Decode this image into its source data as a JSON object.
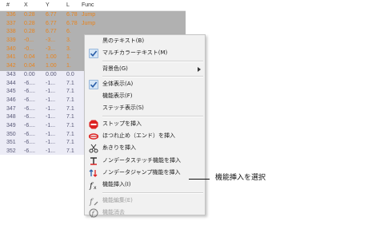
{
  "table": {
    "headers": [
      "#",
      "X",
      "Y",
      "L",
      "Func"
    ],
    "rows": [
      {
        "cells": [
          "336",
          "0.28",
          "6.77",
          "6.78",
          "Jump"
        ],
        "selected": true
      },
      {
        "cells": [
          "337",
          "0.28",
          "6.77",
          "6.78",
          "Jump"
        ],
        "selected": true
      },
      {
        "cells": [
          "338",
          "0.28",
          "6.77",
          "6.",
          ""
        ],
        "selected": true
      },
      {
        "cells": [
          "339",
          "-0...",
          "-3...",
          "3.",
          ""
        ],
        "selected": true
      },
      {
        "cells": [
          "340",
          "-0...",
          "-3...",
          "3.",
          ""
        ],
        "selected": true
      },
      {
        "cells": [
          "341",
          "0.04",
          "1.00",
          "1.",
          ""
        ],
        "selected": true
      },
      {
        "cells": [
          "342",
          "0.04",
          "1.00",
          "1.",
          ""
        ],
        "selected": true
      },
      {
        "cells": [
          "343",
          "0.00",
          "0.00",
          "0.0",
          ""
        ],
        "selected": false
      },
      {
        "cells": [
          "344",
          "-6....",
          "-1...",
          "7.1",
          ""
        ],
        "selected": false
      },
      {
        "cells": [
          "345",
          "-6....",
          "-1...",
          "7.1",
          ""
        ],
        "selected": false
      },
      {
        "cells": [
          "346",
          "-6....",
          "-1...",
          "7.1",
          ""
        ],
        "selected": false
      },
      {
        "cells": [
          "347",
          "-6....",
          "-1...",
          "7.1",
          ""
        ],
        "selected": false
      },
      {
        "cells": [
          "348",
          "-6....",
          "-1...",
          "7.1",
          ""
        ],
        "selected": false
      },
      {
        "cells": [
          "349",
          "-6....",
          "-1...",
          "7.1",
          ""
        ],
        "selected": false
      },
      {
        "cells": [
          "350",
          "-6....",
          "-1...",
          "7.1",
          ""
        ],
        "selected": false
      },
      {
        "cells": [
          "351",
          "-6....",
          "-1...",
          "7.1",
          ""
        ],
        "selected": false
      },
      {
        "cells": [
          "352",
          "-6....",
          "-1...",
          "7.1",
          ""
        ],
        "selected": false
      }
    ]
  },
  "menu": {
    "items": [
      {
        "label": "黒のテキスト(B)",
        "icon": "",
        "checked": false,
        "disabled": false
      },
      {
        "label": "マルチカラーテキスト(M)",
        "icon": "check-icon",
        "checked": true,
        "disabled": false
      },
      {
        "sep": true
      },
      {
        "label": "背景色(G)",
        "icon": "",
        "checked": false,
        "disabled": false,
        "submenu": true
      },
      {
        "sep": true
      },
      {
        "label": "全体表示(A)",
        "icon": "check-icon",
        "checked": true,
        "disabled": false
      },
      {
        "label": "機能表示(F)",
        "icon": "",
        "checked": false,
        "disabled": false
      },
      {
        "label": "ステッチ表示(S)",
        "icon": "",
        "checked": false,
        "disabled": false
      },
      {
        "sep": true
      },
      {
        "label": "ストップを挿入",
        "icon": "stop-icon",
        "checked": false,
        "disabled": false
      },
      {
        "label": "ほつれ止め（エンド）を挿入",
        "icon": "tie-off-icon",
        "checked": false,
        "disabled": false
      },
      {
        "label": "糸きりを挿入",
        "icon": "trim-icon",
        "checked": false,
        "disabled": false
      },
      {
        "label": "ノンデータステッチ機能を挿入",
        "icon": "stitch-function-icon",
        "checked": false,
        "disabled": false
      },
      {
        "label": "ノンデータジャンプ機能を挿入",
        "icon": "jump-function-icon",
        "checked": false,
        "disabled": false
      },
      {
        "label": "機能挿入(I)",
        "icon": "function-insert-icon",
        "checked": false,
        "disabled": false
      },
      {
        "sep": true
      },
      {
        "label": "機能編集(E)",
        "icon": "function-edit-icon",
        "checked": false,
        "disabled": true
      },
      {
        "label": "機能消去",
        "icon": "function-delete-icon",
        "checked": false,
        "disabled": true
      }
    ]
  },
  "callout": {
    "text": "機能挿入を選択"
  },
  "colors": {
    "selected_row_bg": "#b1b1b1",
    "selected_row_text": "#e8831c",
    "normal_row_bg": "#ececf6",
    "normal_row_text": "#5a5a78",
    "menu_bg": "#f1f1f1",
    "check_bg": "#d6e6f6"
  }
}
